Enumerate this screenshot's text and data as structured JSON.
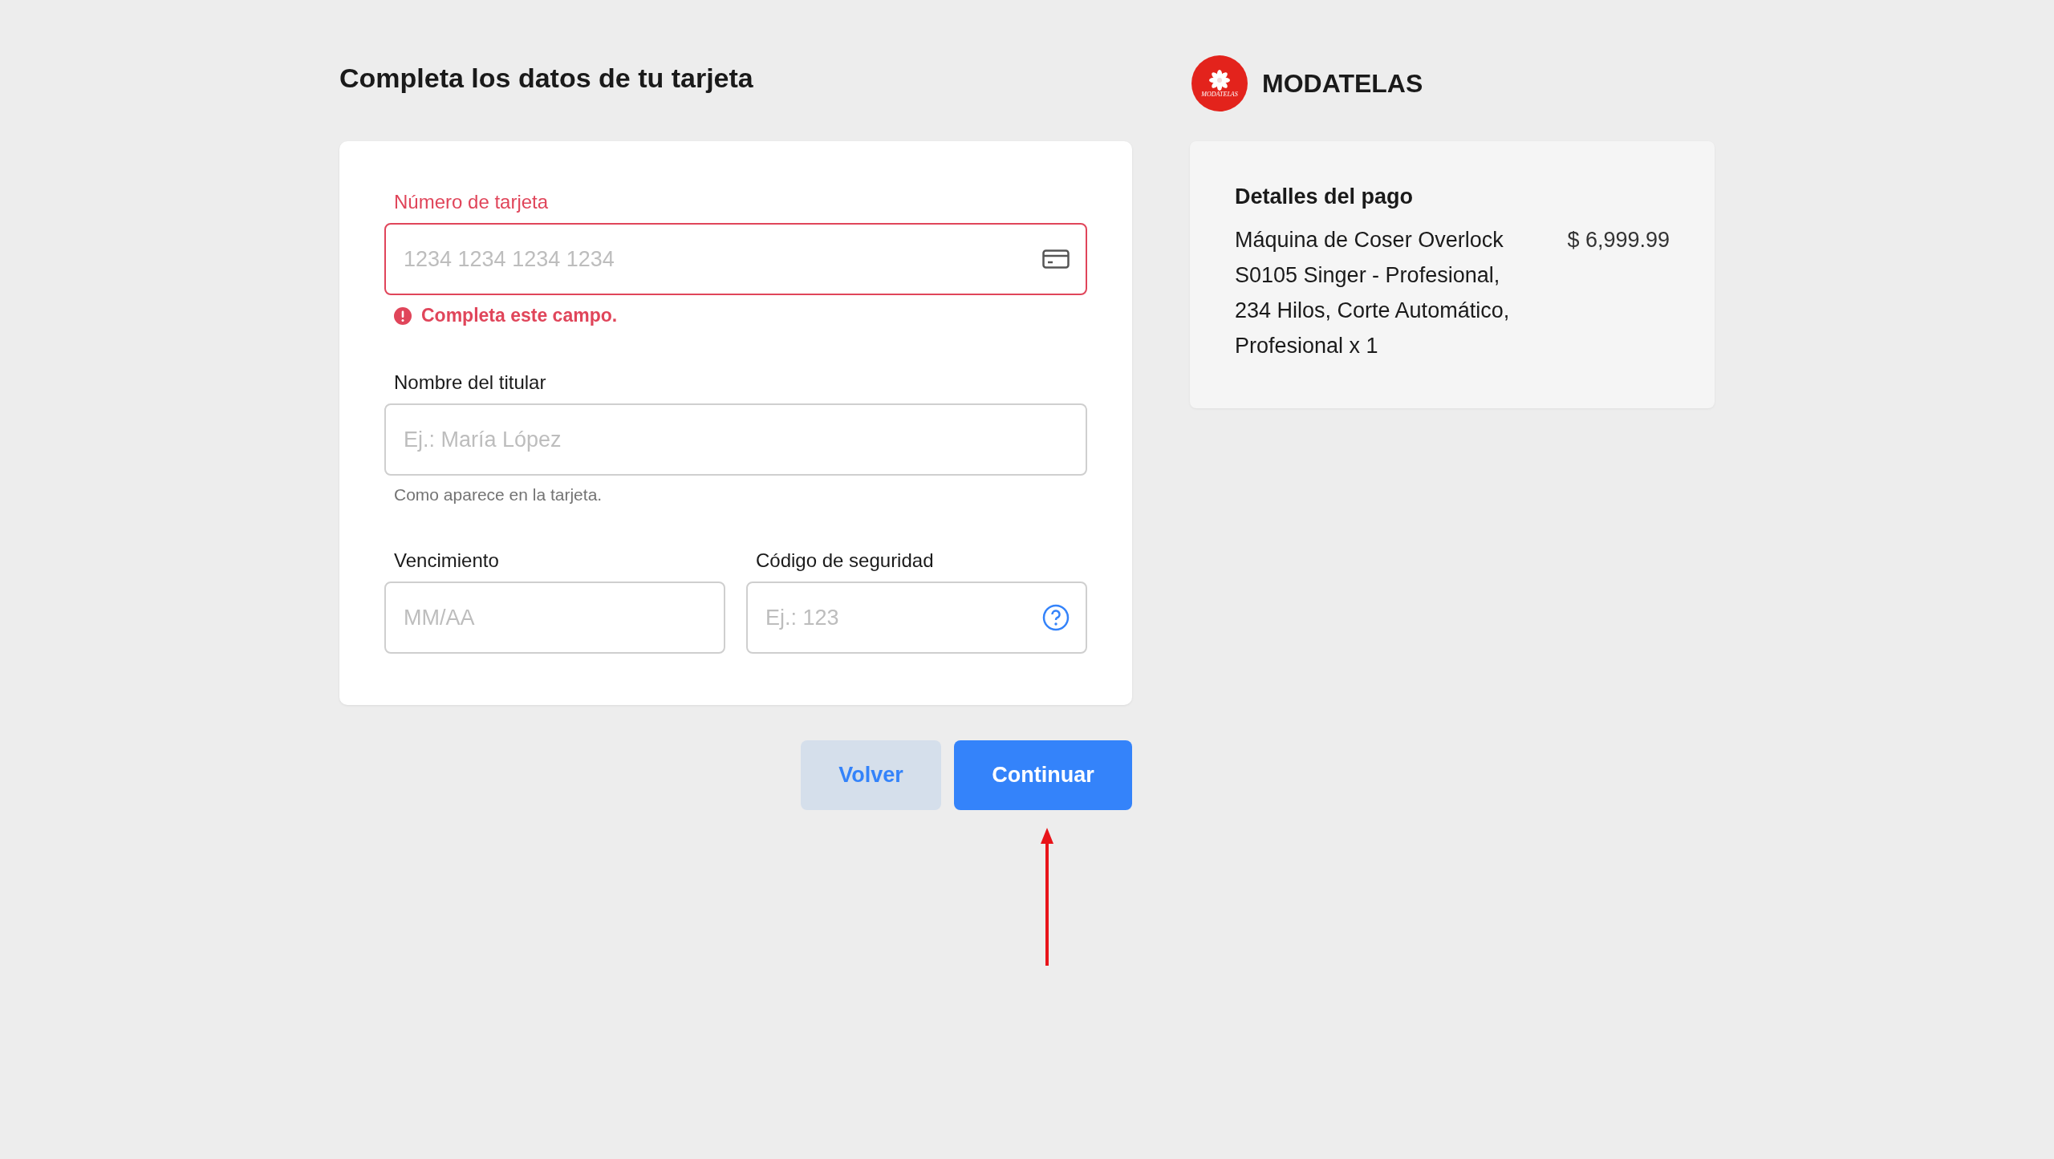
{
  "title": "Completa los datos de tu tarjeta",
  "fields": [
    {
      "label": "Número de tarjeta",
      "placeholder": "1234 1234 1234 1234",
      "invalid": true,
      "error": "Completa este campo.",
      "kind": "card_number"
    },
    {
      "label": "Nombre del titular",
      "placeholder": "Ej.: María López",
      "invalid": false,
      "hint": "Como aparece en la tarjeta.",
      "kind": "text"
    }
  ],
  "row_fields": [
    {
      "label": "Vencimiento",
      "placeholder": "MM/AA",
      "invalid": false,
      "kind": "expiry"
    },
    {
      "label": "Código de seguridad",
      "placeholder": "Ej.: 123",
      "invalid": false,
      "kind": "cvv"
    }
  ],
  "buttons": [
    {
      "label": "Volver",
      "kind": "secondary"
    },
    {
      "label": "Continuar",
      "kind": "primary"
    }
  ],
  "store": {
    "logo_text": "MODATELAS",
    "name": "MODATELAS"
  },
  "summary": {
    "title": "Detalles del pago",
    "items": [
      {
        "description": "Máquina de Coser Overlock S0105 Singer - Profesional, 234 Hilos, Corte Automático, Profesional x 1",
        "price": "$ 6,999.99"
      }
    ]
  }
}
